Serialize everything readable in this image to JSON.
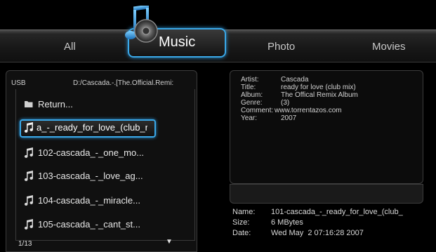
{
  "tabs": {
    "all": "All",
    "music": "Music",
    "photo": "Photo",
    "movies": "Movies"
  },
  "browser": {
    "source": "USB",
    "path": "D:/Cascada.-.[The.Official.Remi:",
    "items": [
      {
        "label": "Return...",
        "icon": "folder-icon"
      },
      {
        "label": "a_-_ready_for_love_(club_r",
        "icon": "music-note-icon",
        "selected": true
      },
      {
        "label": "102-cascada_-_one_mo...",
        "icon": "music-note-icon"
      },
      {
        "label": "103-cascada_-_love_ag...",
        "icon": "music-note-icon"
      },
      {
        "label": "104-cascada_-_miracle...",
        "icon": "music-note-icon"
      },
      {
        "label": "105-cascada_-_cant_st...",
        "icon": "music-note-icon"
      }
    ],
    "page": "1/13",
    "scroll_arrow": "▼"
  },
  "tags": {
    "artist_key": "Artist:",
    "artist": "Cascada",
    "title_key": "Title:",
    "title": "ready for love (club mix)",
    "album_key": "Album:",
    "album": "The Offical Remix Album",
    "genre_key": "Genre:",
    "genre": "(3)",
    "comment_key": "Comment:",
    "comment": "www.torrentazos.com",
    "year_key": "Year:",
    "year": "2007"
  },
  "file": {
    "name_key": "Name:",
    "name": "101-cascada_-_ready_for_love_(club_",
    "size_key": "Size:",
    "size": "6 MBytes",
    "date_key": "Date:",
    "date": "Wed May  2 07:16:28 2007"
  },
  "colors": {
    "accent": "#3aa8e8",
    "background": "#000000"
  }
}
